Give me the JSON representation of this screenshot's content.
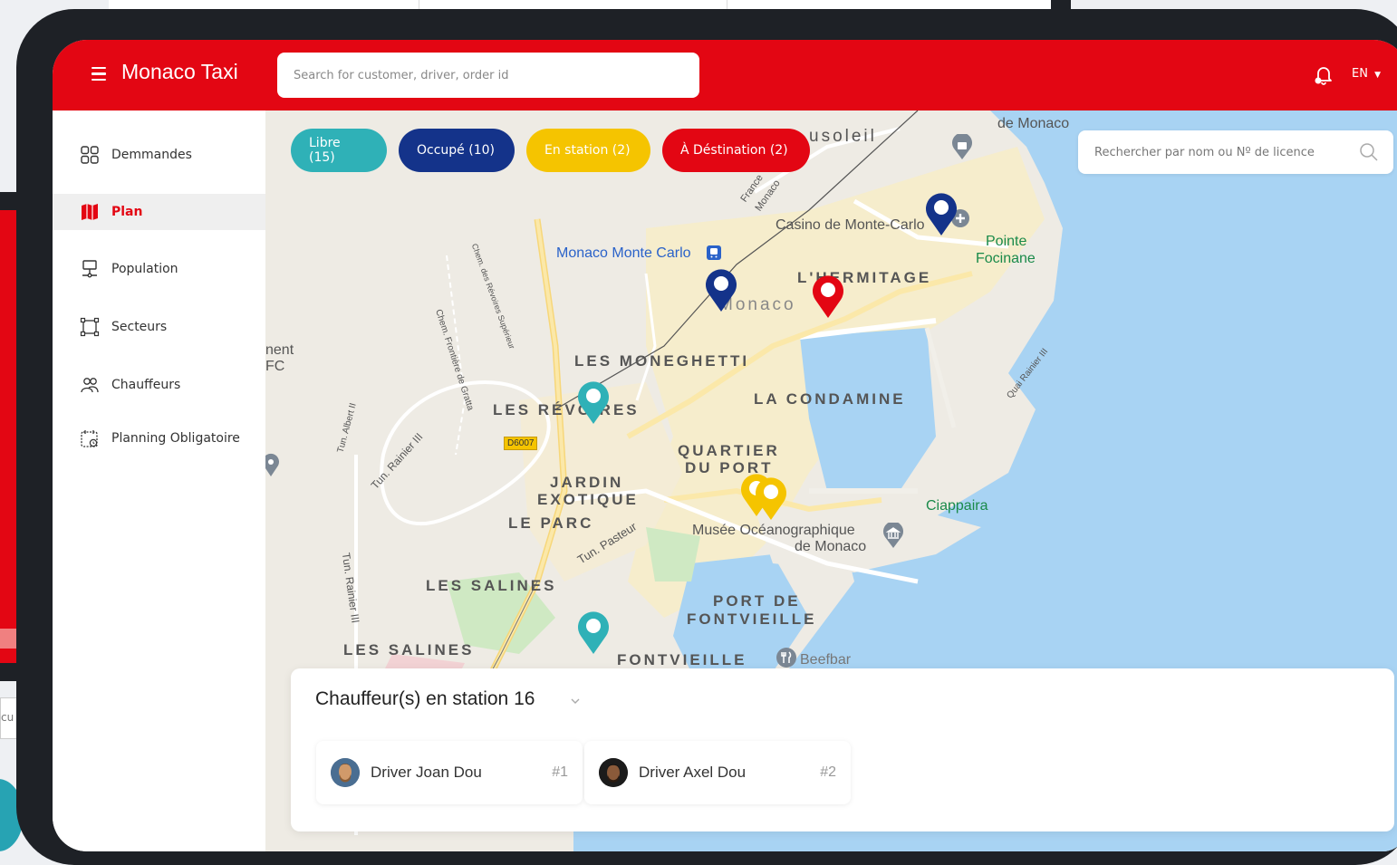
{
  "app": {
    "title": "Monaco Taxi",
    "search_placeholder": "Search for customer, driver, order id",
    "language": "EN",
    "brand_color": "#e30613"
  },
  "sidebar": {
    "items": [
      {
        "label": "Demmandes",
        "icon": "grid-icon",
        "active": false
      },
      {
        "label": "Plan",
        "icon": "map-icon",
        "active": true
      },
      {
        "label": "Population",
        "icon": "monitor-icon",
        "active": false
      },
      {
        "label": "Secteurs",
        "icon": "sectors-icon",
        "active": false
      },
      {
        "label": "Chauffeurs",
        "icon": "drivers-icon",
        "active": false
      },
      {
        "label": "Planning Obligatoire",
        "icon": "calendar-icon",
        "active": false
      }
    ]
  },
  "map": {
    "filters": [
      {
        "label": "Libre (15)",
        "color": "#2fb1b7"
      },
      {
        "label": "Occupé (10)",
        "color": "#14338a"
      },
      {
        "label": "En station (2)",
        "color": "#f5c400"
      },
      {
        "label": "À Déstination (2)",
        "color": "#e30613"
      }
    ],
    "search_placeholder": "Rechercher par nom ou Nº de licence",
    "labels": {
      "beausoleil": "usoleil",
      "jardin_exotique_monaco": "de Monaco",
      "casino": "Casino de Monte-Carlo",
      "pointe_focinane_1": "Pointe",
      "pointe_focinane_2": "Focinane",
      "station": "Monaco Monte Carlo",
      "hermitage": "L'HERMITAGE",
      "monaco": "Monaco",
      "moneghetti": "LES MONEGHETTI",
      "revoires": "LES RÉVOIRES",
      "condamine": "LA CONDAMINE",
      "quartier1": "QUARTIER",
      "quartier2": "DU PORT",
      "jardin1": "JARDIN",
      "jardin2": "EXOTIQUE",
      "leparc": "LE PARC",
      "ciappaira": "Ciappaira",
      "musee1": "Musée Océanographique",
      "musee2": "de Monaco",
      "salines": "LES SALINES",
      "salines2": "LES SALINES",
      "port1": "PORT DE",
      "port2": "FONTVIEILLE",
      "fontvieille": "FONTVIEILLE",
      "beefbar": "Beefbar",
      "d6007": "D6007",
      "pasteur": "Tun. Pasteur",
      "rainier": "Tun. Rainier III",
      "rainier2": "Tun. Rainier III",
      "albert": "Tun. Albert II",
      "quai": "Quai Rainier III",
      "france": "France",
      "monaco_rot": "Monaco",
      "chem1": "Chem. des Révoires Supérieur",
      "chem2": "Chem. Frontière de Gratta",
      "ment": "nent",
      "fc": "FC"
    }
  },
  "panel": {
    "title": "Chauffeur(s) en station 16",
    "drivers": [
      {
        "name": "Driver Joan Dou",
        "rank": "#1"
      },
      {
        "name": "Driver Axel Dou",
        "rank": "#2"
      }
    ]
  },
  "background": {
    "partial_text": "cu"
  }
}
